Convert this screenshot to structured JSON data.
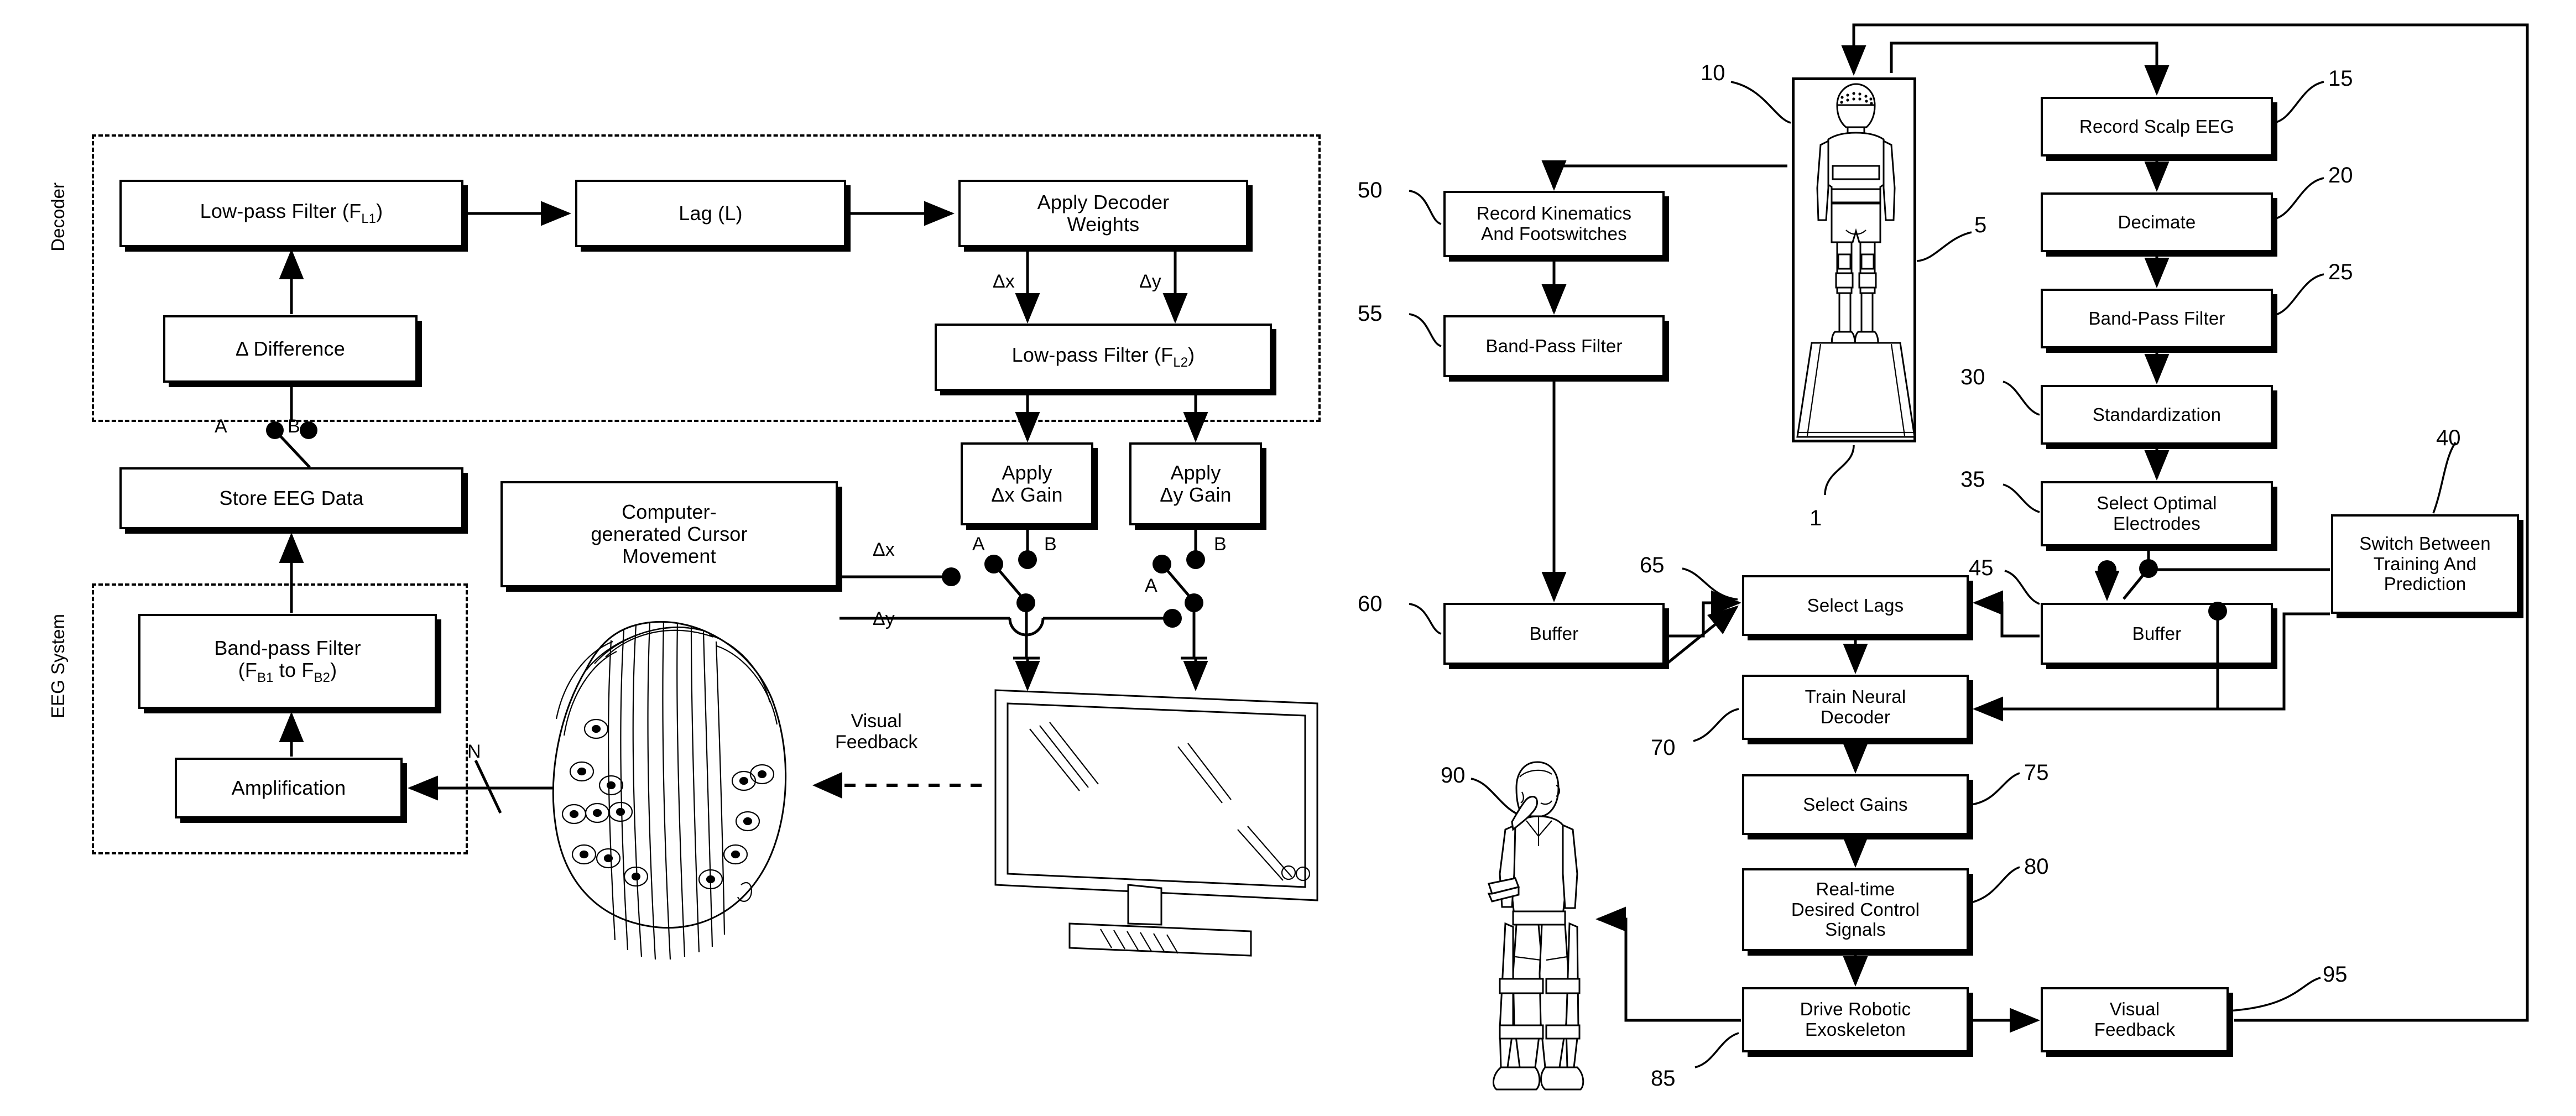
{
  "figure": {
    "left_panel": {
      "group_labels": {
        "decoder": "Decoder",
        "eeg_system": "EEG System"
      },
      "boxes": {
        "low_pass_filter_1": {
          "text": "Low-pass Filter (F",
          "sub": "L1",
          "tail": ")"
        },
        "lag": "Lag (L)",
        "apply_decoder_weights": "Apply Decoder\nWeights",
        "difference": "Δ Difference",
        "low_pass_filter_2": {
          "text": "Low-pass Filter (F",
          "sub": "L2",
          "tail": ")"
        },
        "store_eeg_data": "Store EEG Data",
        "band_pass_filter": {
          "text": "Band-pass Filter\n(F",
          "sub1": "B1",
          "mid": " to F",
          "sub2": "B2",
          "tail": ")"
        },
        "amplification": "Amplification",
        "cursor_movement": "Computer-\ngenerated Cursor\nMovement",
        "apply_dx_gain": "Apply\nΔx Gain",
        "apply_dy_gain": "Apply\nΔy Gain"
      },
      "signal_labels": {
        "dx_top": "Δx",
        "dy_top": "Δy",
        "dx_cursor": "Δx",
        "dy_cursor": "Δy",
        "channels": "N",
        "visual_feedback": "Visual\nFeedback"
      },
      "switch_labels": {
        "store_a": "A",
        "store_b": "B",
        "dx_a": "A",
        "dx_b": "B",
        "dy_a": "A",
        "dy_b": "B"
      },
      "artwork": {
        "eeg_cap": "eeg-electrode-cap-head",
        "monitor": "computer-monitor"
      }
    },
    "right_panel": {
      "boxes": {
        "record_kinematics": "Record Kinematics\nAnd Footswitches",
        "band_pass_filter_left": "Band-Pass Filter",
        "buffer_left": "Buffer",
        "record_scalp_eeg": "Record Scalp EEG",
        "decimate": "Decimate",
        "band_pass_filter_right": "Band-Pass Filter",
        "standardization": "Standardization",
        "select_optimal_electrodes": "Select Optimal\nElectrodes",
        "switch_training_prediction": "Switch Between\nTraining And\nPrediction",
        "buffer_right": "Buffer",
        "select_lags": "Select Lags",
        "train_neural_decoder": "Train Neural\nDecoder",
        "select_gains": "Select Gains",
        "realtime_control_signals": "Real-time\nDesired Control\nSignals",
        "drive_robotic_exoskeleton": "Drive Robotic\nExoskeleton",
        "visual_feedback": "Visual\nFeedback"
      },
      "reference_numerals": {
        "subject_enclosure": "10",
        "subject": "5",
        "treadmill": "1",
        "record_kinematics": "50",
        "band_pass_filter_left": "55",
        "buffer_left": "60",
        "record_scalp_eeg": "15",
        "decimate": "20",
        "band_pass_filter_right": "25",
        "standardization": "30",
        "select_optimal_electrodes": "35",
        "switch_training_prediction": "40",
        "buffer_right": "45",
        "select_lags": "65",
        "train_neural_decoder": "70",
        "select_gains": "75",
        "realtime_control_signals": "80",
        "drive_robotic_exoskeleton": "85",
        "exoskeleton_user": "90",
        "visual_feedback": "95"
      },
      "artwork": {
        "subject_on_treadmill": "person-with-eeg-cap-on-treadmill",
        "exoskeleton_user": "person-wearing-robotic-exoskeleton"
      }
    }
  }
}
